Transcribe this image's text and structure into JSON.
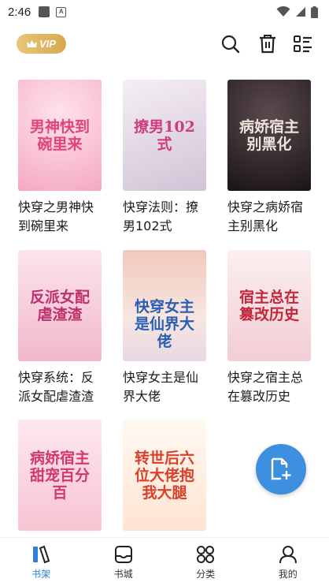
{
  "status_bar": {
    "time": "2:46",
    "battery_level": 1.0
  },
  "header": {
    "vip_label": "VIP"
  },
  "books": [
    {
      "title_line1": "快穿之男神快",
      "title_line2": "到碗里来",
      "cover_title": "男神快到碗里来",
      "cover_bg": "#f7c6d4",
      "cover_fg": "#e0457a"
    },
    {
      "title_line1": "快穿法则：撩",
      "title_line2": "男102式",
      "cover_title": "撩男102式",
      "cover_bg": "#ece8f0",
      "cover_fg": "#d23a80"
    },
    {
      "title_line1": "快穿之病娇宿",
      "title_line2": "主别黑化",
      "cover_title": "病娇宿主别黑化",
      "cover_bg": "#2a2226",
      "cover_fg": "#e8e0d8"
    },
    {
      "title_line1": "快穿系统：反",
      "title_line2": "派女配虐渣渣",
      "cover_title": "反派女配虐渣渣",
      "cover_bg": "#f5d6e0",
      "cover_fg": "#c0306a"
    },
    {
      "title_line1": "快穿女主是仙",
      "title_line2": "界大佬",
      "cover_title": "快穿女主是仙界大佬",
      "cover_bg": "#f3d8d6",
      "cover_fg": "#2a5fb4"
    },
    {
      "title_line1": "快穿之宿主总",
      "title_line2": "在篡改历史",
      "cover_title": "宿主总在篡改历史",
      "cover_bg": "#f8e6e6",
      "cover_fg": "#c2283c"
    },
    {
      "title_line1": "",
      "title_line2": "",
      "cover_title": "病娇宿主甜宠百分百",
      "cover_bg": "#fbe3ea",
      "cover_fg": "#d2386a"
    },
    {
      "title_line1": "",
      "title_line2": "",
      "cover_title": "转世后六位大佬抱我大腿",
      "cover_bg": "#fff6ee",
      "cover_fg": "#d8402c"
    }
  ],
  "nav": [
    {
      "label": "书架",
      "icon": "bookshelf-icon",
      "active": true
    },
    {
      "label": "书城",
      "icon": "bookstore-icon",
      "active": false
    },
    {
      "label": "分类",
      "icon": "category-icon",
      "active": false
    },
    {
      "label": "我的",
      "icon": "profile-icon",
      "active": false
    }
  ],
  "colors": {
    "accent": "#2f7fd8",
    "fab": "#3d8fe0",
    "vip_gold": "#d7a94d"
  }
}
